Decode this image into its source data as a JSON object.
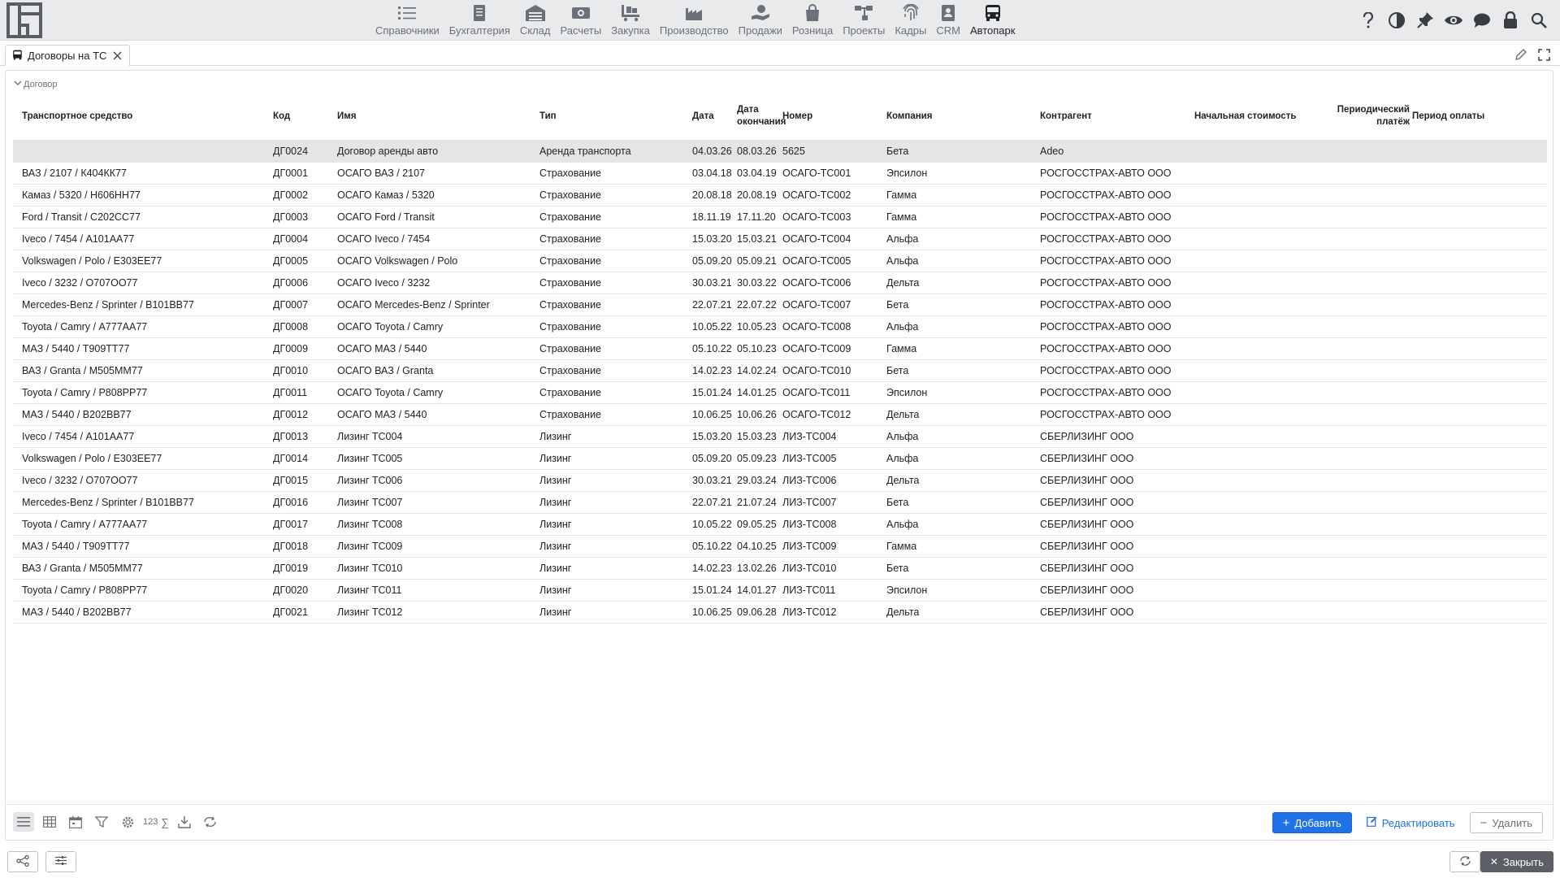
{
  "nav": {
    "items": [
      {
        "label": "Справочники",
        "icon": "list-icon"
      },
      {
        "label": "Бухгалтерия",
        "icon": "ledger-icon"
      },
      {
        "label": "Склад",
        "icon": "warehouse-icon"
      },
      {
        "label": "Расчеты",
        "icon": "money-icon"
      },
      {
        "label": "Закупка",
        "icon": "cart-icon"
      },
      {
        "label": "Производство",
        "icon": "factory-icon"
      },
      {
        "label": "Продажи",
        "icon": "sales-icon"
      },
      {
        "label": "Розница",
        "icon": "bag-icon"
      },
      {
        "label": "Проекты",
        "icon": "projects-icon"
      },
      {
        "label": "Кадры",
        "icon": "fingerprint-icon"
      },
      {
        "label": "CRM",
        "icon": "crm-icon"
      },
      {
        "label": "Автопарк",
        "icon": "bus-icon"
      }
    ],
    "active": "Автопарк"
  },
  "tab": {
    "label": "Договоры на ТС"
  },
  "group": {
    "label": "Договор"
  },
  "columns": {
    "vehicle": "Транспортное средство",
    "code": "Код",
    "name": "Имя",
    "type": "Тип",
    "date": "Дата",
    "end_date": "Дата окончания",
    "number": "Номер",
    "company": "Компания",
    "contractor": "Контрагент",
    "initial_cost": "Начальная стоимость",
    "periodic_payment": "Периодический платёж",
    "payment_period": "Период оплаты"
  },
  "rows": [
    {
      "vehicle": "",
      "code": "ДГ0024",
      "name": "Договор аренды авто",
      "type": "Аренда транспорта",
      "date": "04.03.26",
      "end": "08.03.26",
      "number": "5625",
      "company": "Бета",
      "contractor": "Adeo"
    },
    {
      "vehicle": "ВАЗ / 2107 / К404КК77",
      "code": "ДГ0001",
      "name": "ОСАГО ВАЗ / 2107",
      "type": "Страхование",
      "date": "03.04.18",
      "end": "03.04.19",
      "number": "ОСАГО-ТС001",
      "company": "Эпсилон",
      "contractor": "РОСГОССТРАХ-АВТО ООО"
    },
    {
      "vehicle": "Камаз / 5320 / Н606НН77",
      "code": "ДГ0002",
      "name": "ОСАГО Камаз / 5320",
      "type": "Страхование",
      "date": "20.08.18",
      "end": "20.08.19",
      "number": "ОСАГО-ТС002",
      "company": "Гамма",
      "contractor": "РОСГОССТРАХ-АВТО ООО"
    },
    {
      "vehicle": "Ford / Transit / С202СС77",
      "code": "ДГ0003",
      "name": "ОСАГО Ford / Transit",
      "type": "Страхование",
      "date": "18.11.19",
      "end": "17.11.20",
      "number": "ОСАГО-ТС003",
      "company": "Гамма",
      "contractor": "РОСГОССТРАХ-АВТО ООО"
    },
    {
      "vehicle": "Iveco / 7454 / А101АА77",
      "code": "ДГ0004",
      "name": "ОСАГО Iveco / 7454",
      "type": "Страхование",
      "date": "15.03.20",
      "end": "15.03.21",
      "number": "ОСАГО-ТС004",
      "company": "Альфа",
      "contractor": "РОСГОССТРАХ-АВТО ООО"
    },
    {
      "vehicle": "Volkswagen / Polo / Е303ЕЕ77",
      "code": "ДГ0005",
      "name": "ОСАГО Volkswagen / Polo",
      "type": "Страхование",
      "date": "05.09.20",
      "end": "05.09.21",
      "number": "ОСАГО-ТС005",
      "company": "Альфа",
      "contractor": "РОСГОССТРАХ-АВТО ООО"
    },
    {
      "vehicle": "Iveco / 3232 / О707ОО77",
      "code": "ДГ0006",
      "name": "ОСАГО Iveco / 3232",
      "type": "Страхование",
      "date": "30.03.21",
      "end": "30.03.22",
      "number": "ОСАГО-ТС006",
      "company": "Дельта",
      "contractor": "РОСГОССТРАХ-АВТО ООО"
    },
    {
      "vehicle": "Mercedes-Benz / Sprinter / В101ВВ77",
      "code": "ДГ0007",
      "name": "ОСАГО Mercedes-Benz / Sprinter",
      "type": "Страхование",
      "date": "22.07.21",
      "end": "22.07.22",
      "number": "ОСАГО-ТС007",
      "company": "Бета",
      "contractor": "РОСГОССТРАХ-АВТО ООО"
    },
    {
      "vehicle": "Toyota / Camry / А777АА77",
      "code": "ДГ0008",
      "name": "ОСАГО Toyota / Camry",
      "type": "Страхование",
      "date": "10.05.22",
      "end": "10.05.23",
      "number": "ОСАГО-ТС008",
      "company": "Альфа",
      "contractor": "РОСГОССТРАХ-АВТО ООО"
    },
    {
      "vehicle": "МАЗ / 5440 / Т909ТТ77",
      "code": "ДГ0009",
      "name": "ОСАГО МАЗ / 5440",
      "type": "Страхование",
      "date": "05.10.22",
      "end": "05.10.23",
      "number": "ОСАГО-ТС009",
      "company": "Гамма",
      "contractor": "РОСГОССТРАХ-АВТО ООО"
    },
    {
      "vehicle": "ВАЗ / Granta / М505ММ77",
      "code": "ДГ0010",
      "name": "ОСАГО ВАЗ / Granta",
      "type": "Страхование",
      "date": "14.02.23",
      "end": "14.02.24",
      "number": "ОСАГО-ТС010",
      "company": "Бета",
      "contractor": "РОСГОССТРАХ-АВТО ООО"
    },
    {
      "vehicle": "Toyota / Camry / Р808РР77",
      "code": "ДГ0011",
      "name": "ОСАГО Toyota / Camry",
      "type": "Страхование",
      "date": "15.01.24",
      "end": "14.01.25",
      "number": "ОСАГО-ТС011",
      "company": "Эпсилон",
      "contractor": "РОСГОССТРАХ-АВТО ООО"
    },
    {
      "vehicle": "МАЗ / 5440 / В202ВВ77",
      "code": "ДГ0012",
      "name": "ОСАГО МАЗ / 5440",
      "type": "Страхование",
      "date": "10.06.25",
      "end": "10.06.26",
      "number": "ОСАГО-ТС012",
      "company": "Дельта",
      "contractor": "РОСГОССТРАХ-АВТО ООО"
    },
    {
      "vehicle": "Iveco / 7454 / А101АА77",
      "code": "ДГ0013",
      "name": "Лизинг ТС004",
      "type": "Лизинг",
      "date": "15.03.20",
      "end": "15.03.23",
      "number": "ЛИЗ-ТС004",
      "company": "Альфа",
      "contractor": "СБЕРЛИЗИНГ ООО"
    },
    {
      "vehicle": "Volkswagen / Polo / Е303ЕЕ77",
      "code": "ДГ0014",
      "name": "Лизинг ТС005",
      "type": "Лизинг",
      "date": "05.09.20",
      "end": "05.09.23",
      "number": "ЛИЗ-ТС005",
      "company": "Альфа",
      "contractor": "СБЕРЛИЗИНГ ООО"
    },
    {
      "vehicle": "Iveco / 3232 / О707ОО77",
      "code": "ДГ0015",
      "name": "Лизинг ТС006",
      "type": "Лизинг",
      "date": "30.03.21",
      "end": "29.03.24",
      "number": "ЛИЗ-ТС006",
      "company": "Дельта",
      "contractor": "СБЕРЛИЗИНГ ООО"
    },
    {
      "vehicle": "Mercedes-Benz / Sprinter / В101ВВ77",
      "code": "ДГ0016",
      "name": "Лизинг ТС007",
      "type": "Лизинг",
      "date": "22.07.21",
      "end": "21.07.24",
      "number": "ЛИЗ-ТС007",
      "company": "Бета",
      "contractor": "СБЕРЛИЗИНГ ООО"
    },
    {
      "vehicle": "Toyota / Camry / А777АА77",
      "code": "ДГ0017",
      "name": "Лизинг ТС008",
      "type": "Лизинг",
      "date": "10.05.22",
      "end": "09.05.25",
      "number": "ЛИЗ-ТС008",
      "company": "Альфа",
      "contractor": "СБЕРЛИЗИНГ ООО"
    },
    {
      "vehicle": "МАЗ / 5440 / Т909ТТ77",
      "code": "ДГ0018",
      "name": "Лизинг ТС009",
      "type": "Лизинг",
      "date": "05.10.22",
      "end": "04.10.25",
      "number": "ЛИЗ-ТС009",
      "company": "Гамма",
      "contractor": "СБЕРЛИЗИНГ ООО"
    },
    {
      "vehicle": "ВАЗ / Granta / М505ММ77",
      "code": "ДГ0019",
      "name": "Лизинг ТС010",
      "type": "Лизинг",
      "date": "14.02.23",
      "end": "13.02.26",
      "number": "ЛИЗ-ТС010",
      "company": "Бета",
      "contractor": "СБЕРЛИЗИНГ ООО"
    },
    {
      "vehicle": "Toyota / Camry / Р808РР77",
      "code": "ДГ0020",
      "name": "Лизинг ТС011",
      "type": "Лизинг",
      "date": "15.01.24",
      "end": "14.01.27",
      "number": "ЛИЗ-ТС011",
      "company": "Эпсилон",
      "contractor": "СБЕРЛИЗИНГ ООО"
    },
    {
      "vehicle": "МАЗ / 5440 / В202ВВ77",
      "code": "ДГ0021",
      "name": "Лизинг ТС012",
      "type": "Лизинг",
      "date": "10.06.25",
      "end": "09.06.28",
      "number": "ЛИЗ-ТС012",
      "company": "Дельта",
      "contractor": "СБЕРЛИЗИНГ ООО"
    }
  ],
  "selected_row": 0,
  "toolbar": {
    "sum_label": "123",
    "add_label": "Добавить",
    "edit_label": "Редактировать",
    "delete_label": "Удалить"
  },
  "footer": {
    "close_label": "Закрыть"
  },
  "colors": {
    "accent": "#1f72e8",
    "nav_bg": "#e9eaec",
    "selected_row": "#e4e5e7",
    "close_button": "#5c5f66"
  }
}
